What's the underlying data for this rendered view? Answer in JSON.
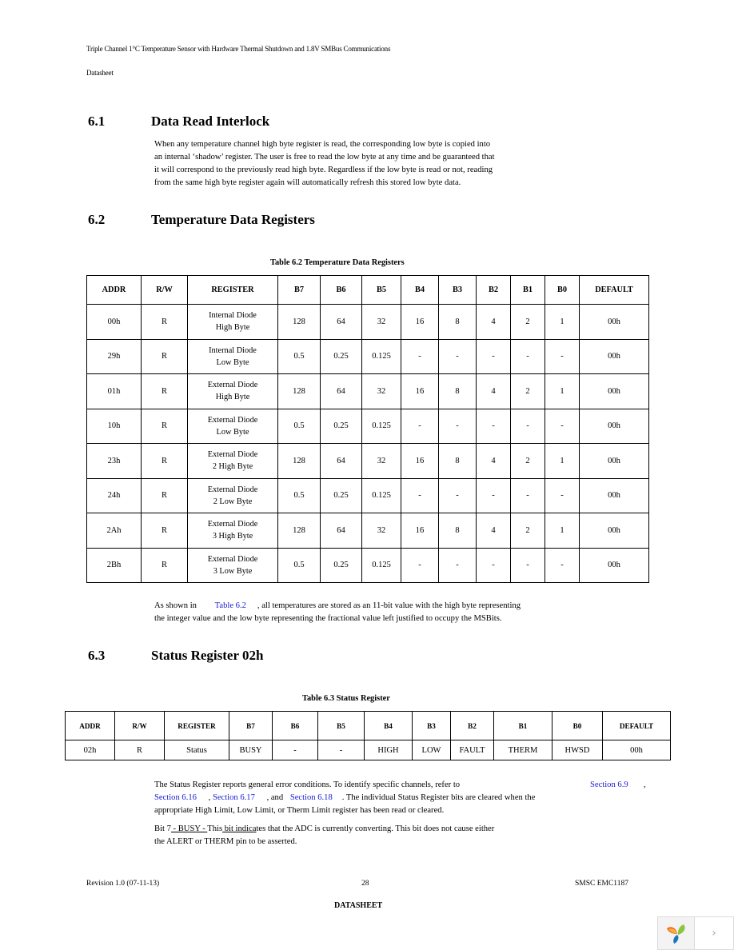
{
  "header": {
    "doc_title": "Triple Channel 1°C Temperature Sensor with Hardware Thermal Shutdown and 1.8V SMBus Communications",
    "doc_type": "Datasheet"
  },
  "sections": [
    {
      "number": "6.1",
      "title": "Data Read Interlock",
      "paragraph_lines": [
        "When any temperature channel high byte register is read, the corresponding low byte is copied into",
        "an internal ‘shadow’ register. The user is free to read the low byte at any time and be guaranteed that",
        "it will correspond to the previously read high byte. Regardless if the low byte is read or not, reading",
        "from the same high byte register again will automatically refresh this stored low byte data."
      ]
    },
    {
      "number": "6.2",
      "title": "Temperature Data Registers",
      "table_caption": "Table 6.2  Temperature Data Registers",
      "after_text": {
        "pre": "As shown in",
        "link": "Table 6.2",
        "post": ", all temperatures are stored as an 11-bit value with the high byte representing",
        "line2": "the integer value and the low byte representing the fractional value left justified to occupy the MSBits."
      }
    },
    {
      "number": "6.3",
      "title": "Status Register 02h",
      "table_caption": "Table 6.3  Status Register",
      "para1": {
        "l1_pre": "The Status Register reports general error conditions. To identify specific channels, refer to",
        "link_69": "Section 6.9",
        "comma": ",",
        "link_616": "Section 6.16",
        "sep1": ",",
        "link_617": "Section 6.17",
        "sep2": ", and",
        "link_618": "Section 6.18",
        "l2_post": ". The individual Status Register bits are cleared when the",
        "l3": "appropriate High Limit, Low Limit, or Therm Limit register has been read or cleared."
      },
      "para2": {
        "bit_label": "Bit 7",
        "busy": " - BUSY - ",
        "this": "This",
        "bit_indica": " bit indica",
        "rest1": "tes that the ADC is currently converting. This bit does not cause either",
        "l2": "the ALERT or THERM pin to be asserted."
      }
    }
  ],
  "table_6_2": {
    "headers": [
      "ADDR",
      "R/W",
      "REGISTER",
      "B7",
      "B6",
      "B5",
      "B4",
      "B3",
      "B2",
      "B1",
      "B0",
      "DEFAULT"
    ],
    "rows": [
      {
        "addr": "00h",
        "rw": "R",
        "reg1": "Internal Diode",
        "reg2": "High Byte",
        "bits": [
          "128",
          "64",
          "32",
          "16",
          "8",
          "4",
          "2",
          "1"
        ],
        "default": "00h"
      },
      {
        "addr": "29h",
        "rw": "R",
        "reg1": "Internal Diode",
        "reg2": "Low Byte",
        "bits": [
          "0.5",
          "0.25",
          "0.125",
          "-",
          "-",
          "-",
          "-",
          "-"
        ],
        "default": "00h"
      },
      {
        "addr": "01h",
        "rw": "R",
        "reg1": "External Diode",
        "reg2": "High Byte",
        "bits": [
          "128",
          "64",
          "32",
          "16",
          "8",
          "4",
          "2",
          "1"
        ],
        "default": "00h"
      },
      {
        "addr": "10h",
        "rw": "R",
        "reg1": "External Diode",
        "reg2": "Low Byte",
        "bits": [
          "0.5",
          "0.25",
          "0.125",
          "-",
          "-",
          "-",
          "-",
          "-"
        ],
        "default": "00h"
      },
      {
        "addr": "23h",
        "rw": "R",
        "reg1": "External Diode",
        "reg2": "2 High Byte",
        "bits": [
          "128",
          "64",
          "32",
          "16",
          "8",
          "4",
          "2",
          "1"
        ],
        "default": "00h"
      },
      {
        "addr": "24h",
        "rw": "R",
        "reg1": "External Diode",
        "reg2": "2 Low Byte",
        "bits": [
          "0.5",
          "0.25",
          "0.125",
          "-",
          "-",
          "-",
          "-",
          "-"
        ],
        "default": "00h"
      },
      {
        "addr": "2Ah",
        "rw": "R",
        "reg1": "External Diode",
        "reg2": "3 High Byte",
        "bits": [
          "128",
          "64",
          "32",
          "16",
          "8",
          "4",
          "2",
          "1"
        ],
        "default": "00h"
      },
      {
        "addr": "2Bh",
        "rw": "R",
        "reg1": "External Diode",
        "reg2": "3 Low Byte",
        "bits": [
          "0.5",
          "0.25",
          "0.125",
          "-",
          "-",
          "-",
          "-",
          "-"
        ],
        "default": "00h"
      }
    ]
  },
  "table_6_3": {
    "headers": [
      "ADDR",
      "R/W",
      "REGISTER",
      "B7",
      "B6",
      "B5",
      "B4",
      "B3",
      "B2",
      "B1",
      "B0",
      "DEFAULT"
    ],
    "row": [
      "02h",
      "R",
      "Status",
      "BUSY",
      "-",
      "-",
      "HIGH",
      "LOW",
      "FAULT",
      "THERM",
      "HWSD",
      "00h"
    ]
  },
  "footer": {
    "revision": "Revision 1.0 (07-11-13)",
    "page_number": "28",
    "part": "SMSC EMC1187",
    "label": "DATASHEET"
  },
  "viewer": {
    "logo_icon": "app-logo-icon",
    "next_icon": "chevron-right-icon",
    "next_glyph": "›"
  }
}
